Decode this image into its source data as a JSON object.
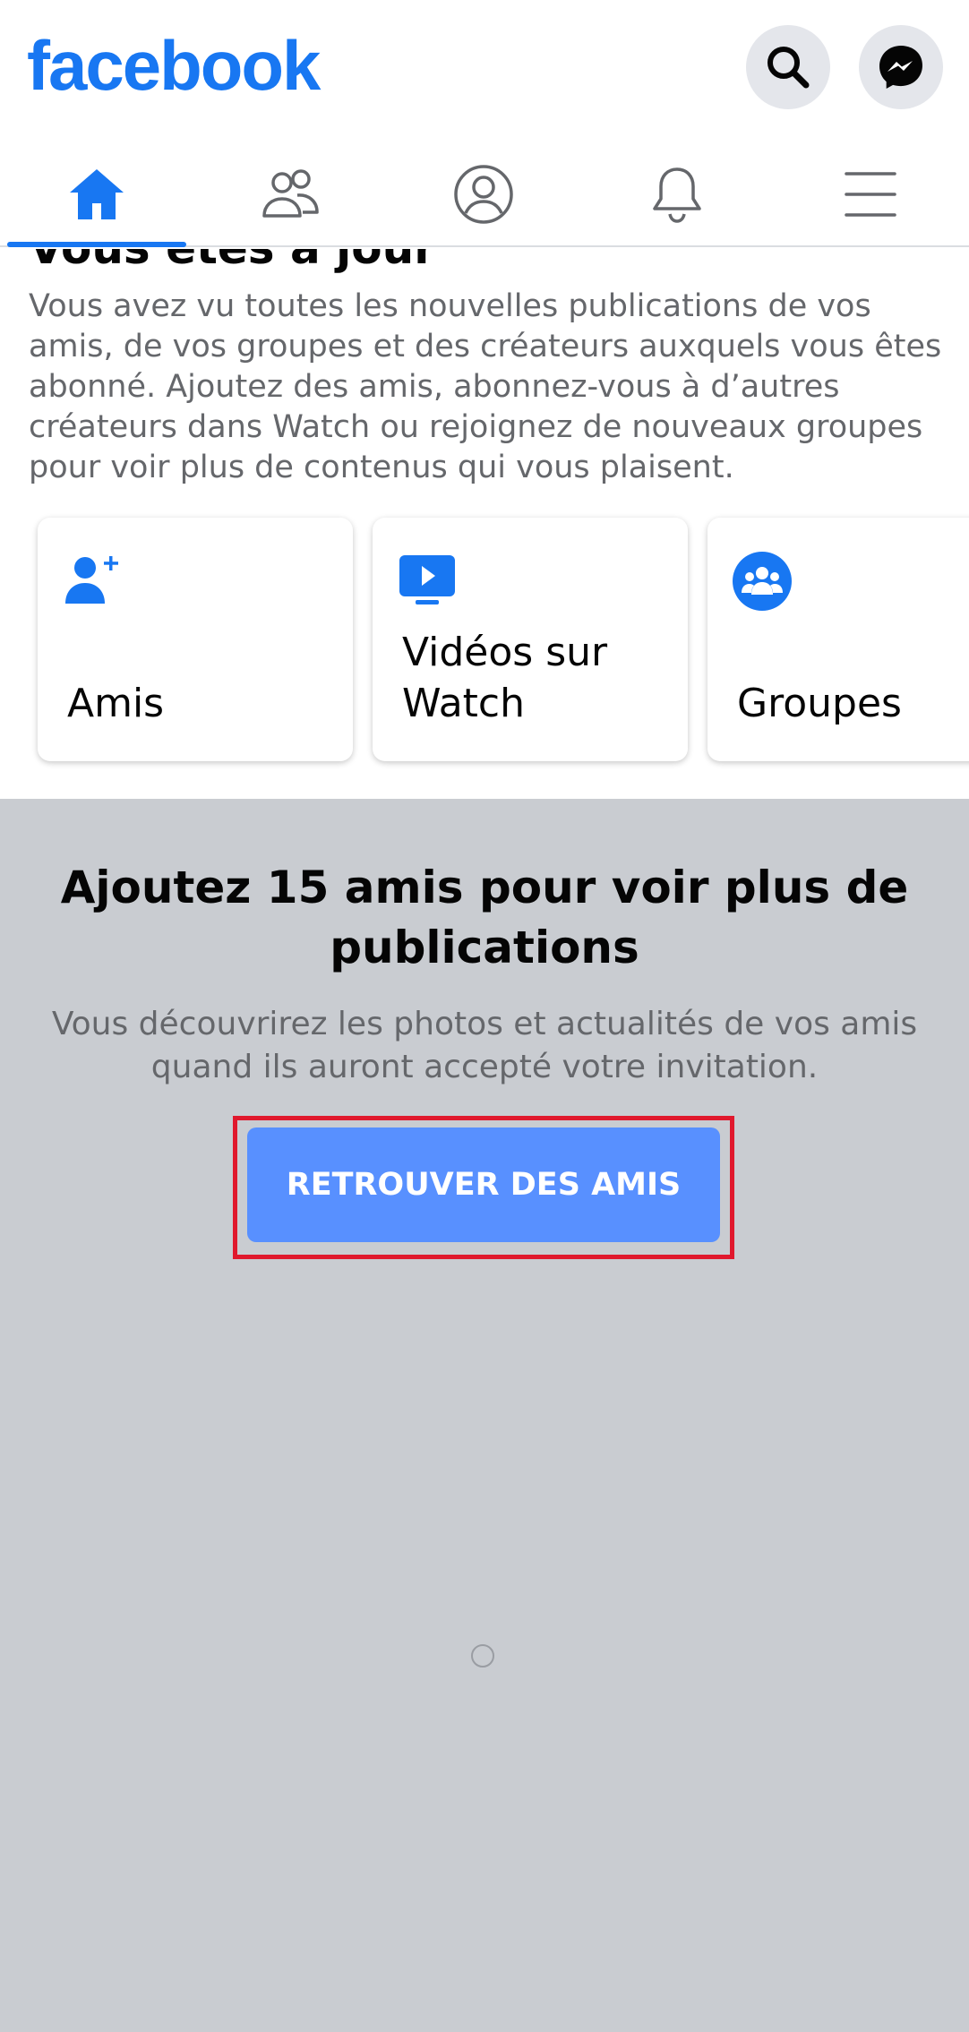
{
  "header": {
    "logo_text": "facebook",
    "search_icon": "search-icon",
    "messenger_icon": "messenger-icon"
  },
  "tabs": [
    {
      "name": "home",
      "icon": "home-icon",
      "active": true
    },
    {
      "name": "friends",
      "icon": "friends-icon",
      "active": false
    },
    {
      "name": "profile",
      "icon": "profile-icon",
      "active": false
    },
    {
      "name": "notifications",
      "icon": "bell-icon",
      "active": false
    },
    {
      "name": "menu",
      "icon": "hamburger-icon",
      "active": false
    }
  ],
  "feed_end": {
    "title": "Vous êtes à jour",
    "text": "Vous avez vu toutes les nouvelles publications de vos amis, de vos groupes et des créateurs auxquels vous êtes abonné. Ajoutez des amis, abonnez-vous à d’autres créateurs dans Watch ou rejoignez de nouveaux groupes pour voir plus de contenus qui vous plaisent."
  },
  "cards": [
    {
      "label": "Amis",
      "icon": "add-friend-icon"
    },
    {
      "label": "Vidéos sur Watch",
      "icon": "watch-video-icon"
    },
    {
      "label": "Groupes",
      "icon": "groups-icon"
    }
  ],
  "promo": {
    "title": "Ajoutez 15 amis pour voir plus de publications",
    "text": "Vous découvrirez les photos et actualités de vos amis quand ils auront accepté votre invitation.",
    "button_label": "RETROUVER DES AMIS"
  },
  "colors": {
    "brand": "#1877f2",
    "button": "#5890ff",
    "gray_background": "#c9ccd1",
    "highlight": "#e0182d"
  }
}
